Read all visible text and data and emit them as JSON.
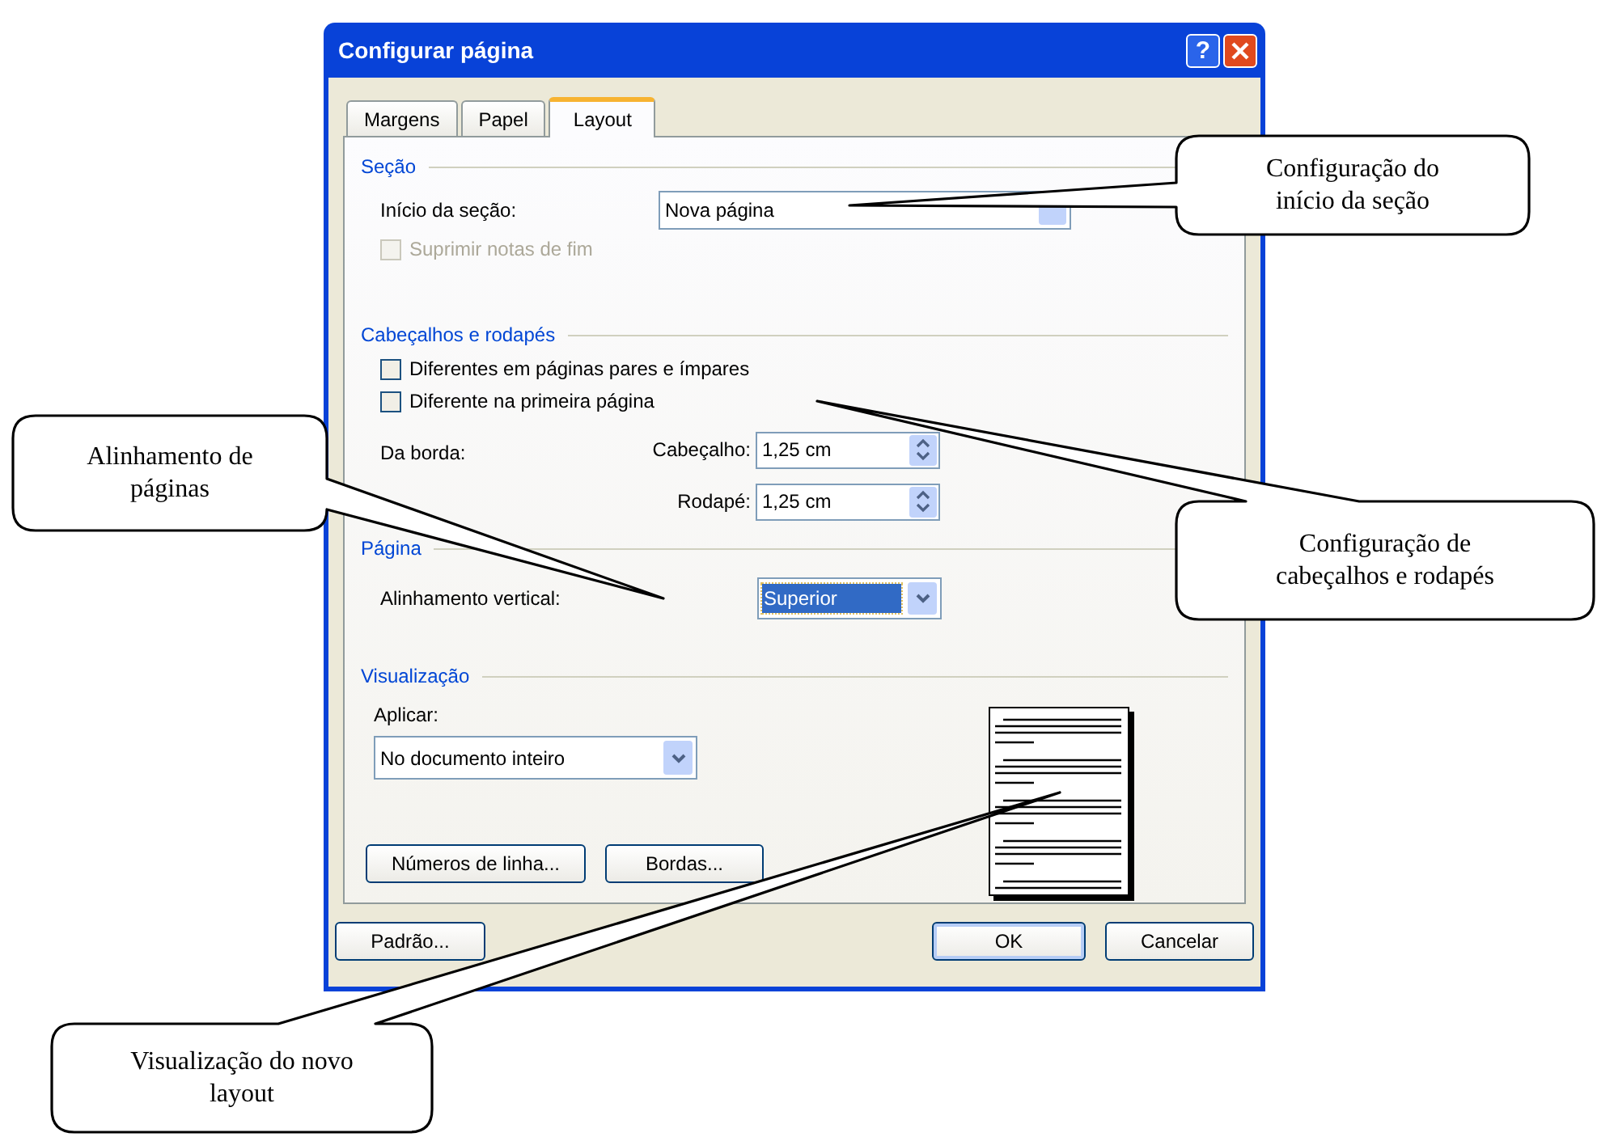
{
  "window": {
    "title": "Configurar página",
    "help_glyph": "?"
  },
  "tabs": [
    {
      "label": "Margens",
      "selected": false
    },
    {
      "label": "Papel",
      "selected": false
    },
    {
      "label": "Layout",
      "selected": true
    }
  ],
  "section": {
    "heading": "Seção",
    "start_label": "Início da seção:",
    "start_value": "Nova página",
    "suppress": {
      "label": "Suprimir notas de fim",
      "checked": false,
      "disabled": true
    }
  },
  "headers_footers": {
    "heading": "Cabeçalhos e rodapés",
    "options": [
      {
        "label": "Diferentes em páginas pares e ímpares",
        "checked": false,
        "disabled": false
      },
      {
        "label": "Diferente na primeira página",
        "checked": false,
        "disabled": false
      }
    ],
    "from_edge_label": "Da borda:",
    "fields": [
      {
        "label": "Cabeçalho:",
        "value": "1,25 cm"
      },
      {
        "label": "Rodapé:",
        "value": "1,25 cm"
      }
    ]
  },
  "page": {
    "heading": "Página",
    "alignment_label": "Alinhamento vertical:",
    "alignment_value": "Superior",
    "focused": true
  },
  "preview": {
    "heading": "Visualização",
    "apply_label": "Aplicar:",
    "apply_value": "No documento inteiro",
    "buttons": [
      "Números de linha...",
      "Bordas..."
    ]
  },
  "footer_buttons": [
    {
      "label": "Padrão...",
      "default": false
    },
    {
      "label": "OK",
      "default": true
    },
    {
      "label": "Cancelar",
      "default": false
    }
  ],
  "callouts": [
    {
      "lines": [
        "Configuração do",
        "início da seção"
      ]
    },
    {
      "lines": [
        "Alinhamento de",
        "páginas"
      ]
    },
    {
      "lines": [
        "Configuração de",
        "cabeçalhos e rodapés"
      ]
    },
    {
      "lines": [
        "Visualização do novo",
        "layout"
      ]
    }
  ]
}
